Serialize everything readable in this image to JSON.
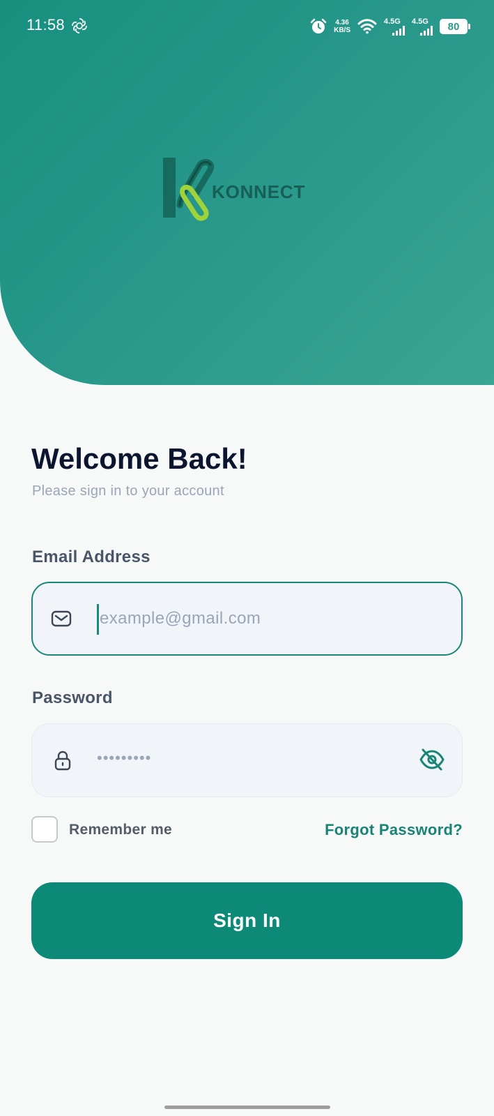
{
  "status_bar": {
    "time": "11:58",
    "net_speed_value": "4.36",
    "net_speed_unit": "KB/S",
    "signal1_label": "4.5G",
    "signal2_label": "4.5G",
    "battery_level": "80",
    "icons": [
      "chatgpt-icon",
      "alarm-icon",
      "wifi-icon",
      "signal-icon",
      "battery-icon"
    ]
  },
  "header": {
    "logo_text": "KONNECT",
    "gradient_colors": [
      "#17907f",
      "#3aa593"
    ]
  },
  "welcome": {
    "title": "Welcome Back!",
    "subtitle": "Please sign in to your account"
  },
  "form": {
    "email": {
      "label": "Email Address",
      "placeholder": "example@gmail.com",
      "value": "",
      "icon": "mail-icon"
    },
    "password": {
      "label": "Password",
      "masked_value": "•••••••••",
      "icon": "lock-icon",
      "toggle_icon": "eye-off-icon"
    },
    "remember_me_label": "Remember me",
    "remember_me_checked": false,
    "forgot_password_label": "Forgot Password?",
    "submit_label": "Sign In"
  },
  "colors": {
    "primary": "#0d8978",
    "title": "#0c1530",
    "muted": "#9aa5b6"
  }
}
